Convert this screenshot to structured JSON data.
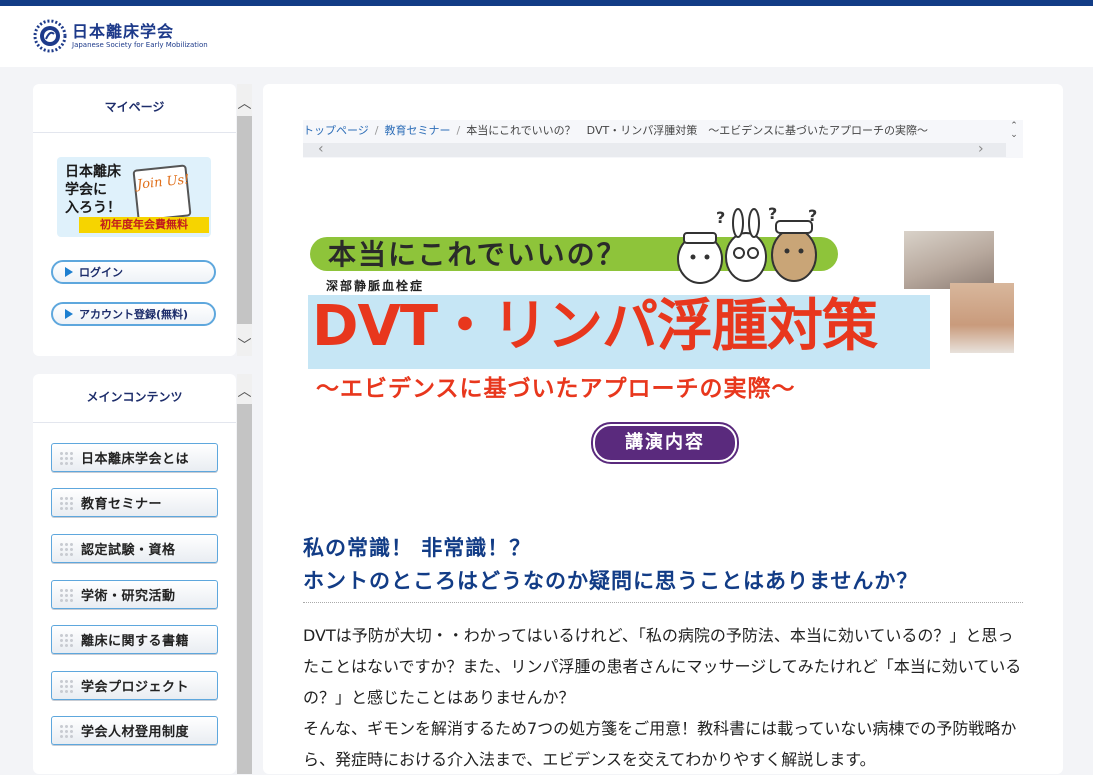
{
  "header": {
    "logo_ja": "日本離床学会",
    "logo_en": "Japanese Society for Early Mobilization"
  },
  "mypage": {
    "title": "マイページ",
    "banner": {
      "line1": "日本離床",
      "line2": "学会に",
      "line3": "入ろう！",
      "script": "Join Us!",
      "free": "初年度年会費無料"
    },
    "login_label": "ログイン",
    "register_label": "アカウント登録(無料)"
  },
  "maincontents": {
    "title": "メインコンテンツ",
    "items": [
      {
        "label": "日本離床学会とは"
      },
      {
        "label": "教育セミナー"
      },
      {
        "label": "認定試験・資格"
      },
      {
        "label": "学術・研究活動"
      },
      {
        "label": "離床に関する書籍"
      },
      {
        "label": "学会プロジェクト"
      },
      {
        "label": "学会人材登用制度"
      }
    ]
  },
  "breadcrumb": {
    "home": "トップページ",
    "category": "教育セミナー",
    "current": "本当にこれでいいの？　DVT・リンパ浮腫対策　～エビデンスに基づいたアプローチの実際～"
  },
  "hero": {
    "question": "本当にこれでいいの？",
    "subtitle": "深部静脈血栓症",
    "title": "DVT・リンパ浮腫対策",
    "title2": "～エビデンスに基づいたアプローチの実際～",
    "badge": "講演内容"
  },
  "article": {
    "headline1": "私の常識！ 非常識！？",
    "headline2": "ホントのところはどうなのか疑問に思うことはありませんか？",
    "para1": "DVTは予防が大切・・わかってはいるけれど、「私の病院の予防法、本当に効いているの？」と思ったことはないですか？また、リンパ浮腫の患者さんにマッサージしてみたけれど「本当に効いているの？」と感じたことはありませんか？",
    "para2": "そんな、ギモンを解消するため7つの処方箋をご用意！教科書には載っていない病棟での予防戦略から、発症時における介入法まで、エビデンスを交えてわかりやすく解説します。"
  },
  "colors": {
    "topbar": "#123c86",
    "headline": "#123c86",
    "title_red": "#e8371d",
    "badge_purple": "#5a2a7d",
    "green_band": "#8ec43a"
  }
}
